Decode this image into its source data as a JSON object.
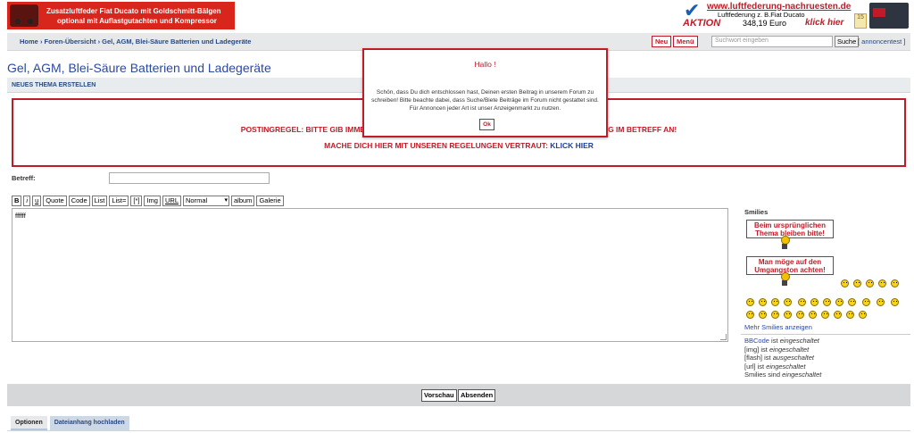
{
  "ad_left": {
    "line1": "Zusatzluftfeder Fiat Ducato mit Goldschmitt-Bälgen",
    "line2": "optional mit Auflastgutachten und Kompressor"
  },
  "ad_right": {
    "url": "www.luftfederung-nachruesten.de",
    "aktion": "AKTION",
    "desc": "Luftfederung z. B.Fiat Ducato",
    "price": "348,19 Euro",
    "cta": "klick hier",
    "badge": "15"
  },
  "nav": {
    "crumbs": [
      "Home",
      "Foren-Übersicht",
      "Gel, AGM, Blei-Säure Batterien und Ladegeräte"
    ],
    "sep": "›",
    "neu_label": "Neu",
    "menu_label": "Menü",
    "search_placeholder": "Suchwort eingeben",
    "search_button": "Suche",
    "search_extra": "annoncentest"
  },
  "page": {
    "title": "Gel, AGM, Blei-Säure Batterien und Ladegeräte",
    "section_header": "NEUES THEMA ERSTELLEN"
  },
  "rules": {
    "line1": "POSTINGREGEL: BITTE GIB IMMER HERSTELLER UND MODELL UND AUCH DIE PROBLEMSTELLUNG IM BETREFF AN!",
    "line2_prefix": "MACHE DICH HIER MIT UNSEREN REGELUNGEN VERTRAUT:",
    "line2_link": "KLICK HIER"
  },
  "form": {
    "betreff_label": "Betreff:",
    "betreff_value": "",
    "editor_text": "ffffff"
  },
  "toolbar": {
    "buttons": [
      "B",
      "i",
      "u",
      "Quote",
      "Code",
      "List",
      "List=",
      "[*]",
      "Img",
      "URL"
    ],
    "size_select": "Normal",
    "extra": [
      "album",
      "Galerie"
    ]
  },
  "smilies": {
    "title": "Smilies",
    "sign1": "Beim ursprünglichen Thema bleiben bitte!",
    "sign2": "Man möge auf den Umgangston achten!",
    "more": "Mehr Smilies anzeigen"
  },
  "status": [
    {
      "name": "BBCode",
      "mid": "ist",
      "state": "eingeschaltet"
    },
    {
      "name": "[img]",
      "mid": "ist",
      "state": "eingeschaltet"
    },
    {
      "name": "[flash]",
      "mid": "ist",
      "state": "ausgeschaltet"
    },
    {
      "name": "[url]",
      "mid": "ist",
      "state": "eingeschaltet"
    },
    {
      "name": "Smilies",
      "mid": "sind",
      "state": "eingeschaltet"
    }
  ],
  "submit": {
    "preview": "Vorschau",
    "send": "Absenden"
  },
  "tabs": [
    "Optionen",
    "Dateianhang hochladen"
  ],
  "modal": {
    "title": "Hallo !",
    "body": "Schön, dass Du dich entschlossen hast, Deinen ersten Beitrag in unserem Forum zu schreiben! Bitte beachte dabei, dass Suche/Biete Beiträge im Forum nicht gestattet sind. Für Annoncen jeder Art ist unser Anzeigenmarkt zu nutzen.",
    "ok": "Ok"
  },
  "colors": {
    "accent_red": "#c01c28",
    "link_blue": "#2a4a9f",
    "nav_bg": "#e6e8ea"
  }
}
